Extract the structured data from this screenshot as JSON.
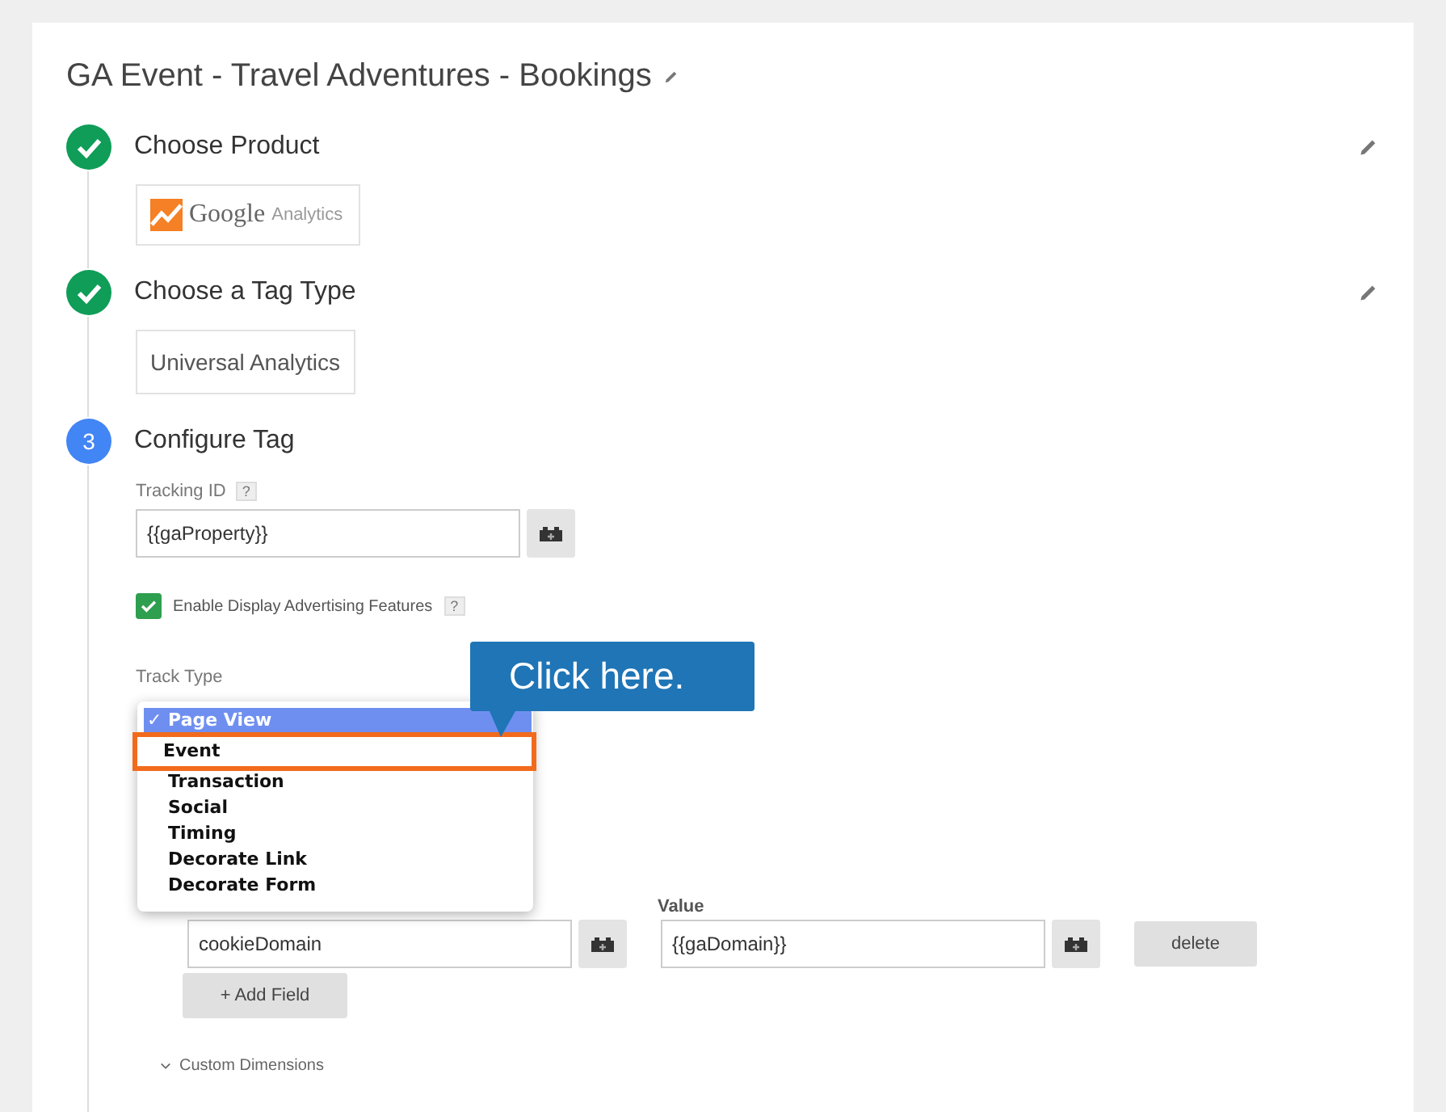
{
  "title": "GA Event - Travel Adventures - Bookings",
  "steps": [
    {
      "done": true,
      "title": "Choose Product",
      "editable": true,
      "kind": "product",
      "logo": {
        "word": "Google",
        "sub": "Analytics"
      }
    },
    {
      "done": true,
      "title": "Choose a Tag Type",
      "editable": true,
      "kind": "tagtype",
      "value": "Universal Analytics"
    },
    {
      "marker": "3",
      "done": false,
      "title": "Configure Tag",
      "editable": false,
      "kind": "config"
    }
  ],
  "config": {
    "tracking_id": {
      "label": "Tracking ID",
      "help": "?",
      "value": "{{gaProperty}}"
    },
    "display_features": {
      "label": "Enable Display Advertising Features",
      "help": "?",
      "checked": true
    },
    "track_type": {
      "label": "Track Type",
      "options": [
        {
          "label": "Page View",
          "mark": "✓",
          "selected": true,
          "highlighted": false
        },
        {
          "label": "Event",
          "selected": false,
          "highlighted": true
        },
        {
          "label": "Transaction",
          "selected": false,
          "highlighted": false
        },
        {
          "label": "Social",
          "selected": false,
          "highlighted": false
        },
        {
          "label": "Timing",
          "selected": false,
          "highlighted": false
        },
        {
          "label": "Decorate Link",
          "selected": false,
          "highlighted": false
        },
        {
          "label": "Decorate Form",
          "selected": false,
          "highlighted": false
        }
      ]
    },
    "callout": "Click here.",
    "fields": {
      "value_label": "Value",
      "rows": [
        {
          "name": "cookieDomain",
          "value": "{{gaDomain}}",
          "delete": "delete"
        }
      ],
      "add": "+ Add Field"
    },
    "custom_dimensions": {
      "label": "Custom Dimensions",
      "expanded": false
    }
  }
}
